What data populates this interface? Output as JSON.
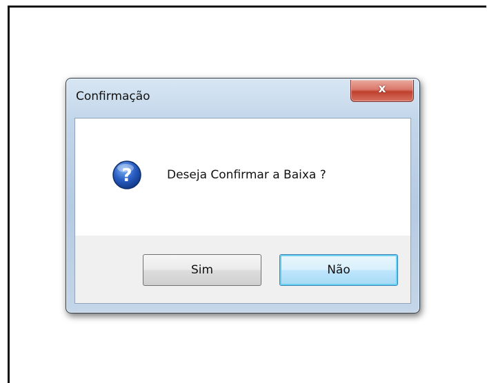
{
  "dialog": {
    "title": "Confirmação",
    "close_symbol": "x",
    "message": "Deseja Confirmar a Baixa ?",
    "icon": "question-icon",
    "buttons": {
      "yes": "Sim",
      "no": "Não"
    },
    "focused_button": "no"
  },
  "colors": {
    "title_bar": "#c2d6ea",
    "close_button": "#c0402e",
    "question_icon": "#1f4fa8",
    "focused_button_border": "#3c7fb1"
  }
}
